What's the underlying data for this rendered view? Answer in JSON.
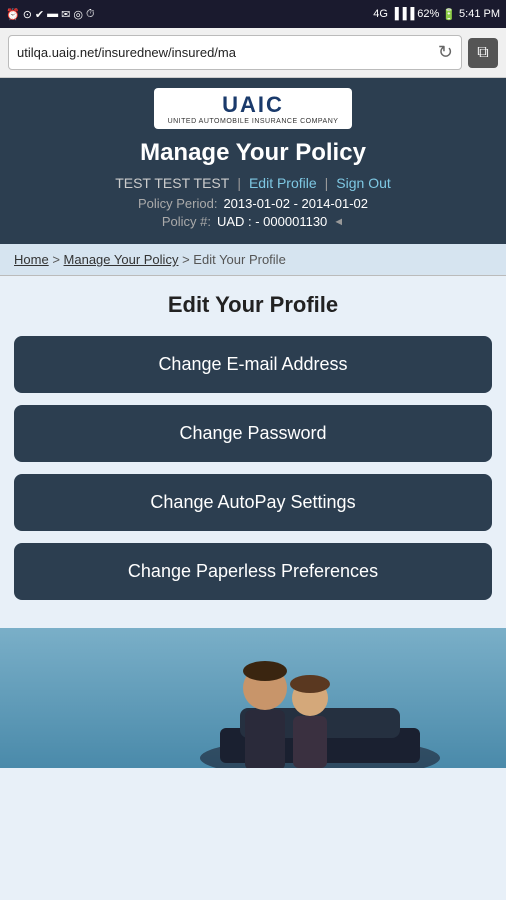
{
  "statusBar": {
    "time": "5:41 PM",
    "battery": "62%",
    "signal": "4G",
    "icons": [
      "alarm",
      "mail",
      "checkmark",
      "battery"
    ]
  },
  "browser": {
    "url": "utilqa.uaig.net/insurednew/insured/ma",
    "reload_icon": "↻",
    "tabs_icon": "⧉"
  },
  "header": {
    "logo": "UAIC",
    "logo_subtitle": "UNITED AUTOMOBILE INSURANCE COMPANY",
    "page_title": "Manage Your Policy",
    "username": "TEST TEST TEST",
    "separator1": "|",
    "edit_profile_link": "Edit Profile",
    "separator2": "|",
    "sign_out_link": "Sign Out",
    "policy_period_label": "Policy Period:",
    "policy_period_value": "2013-01-02 - 2014-01-02",
    "policy_num_label": "Policy #:",
    "policy_num_value": "UAD : - 000001130",
    "triangle": "◄"
  },
  "breadcrumb": {
    "home": "Home",
    "sep1": ">",
    "manage": "Manage Your Policy",
    "sep2": ">",
    "current": "Edit Your Profile"
  },
  "content": {
    "section_title": "Edit Your Profile",
    "buttons": [
      {
        "label": "Change E-mail Address",
        "id": "change-email"
      },
      {
        "label": "Change Password",
        "id": "change-password"
      },
      {
        "label": "Change AutoPay Settings",
        "id": "change-autopay"
      },
      {
        "label": "Change Paperless Preferences",
        "id": "change-paperless"
      }
    ]
  }
}
